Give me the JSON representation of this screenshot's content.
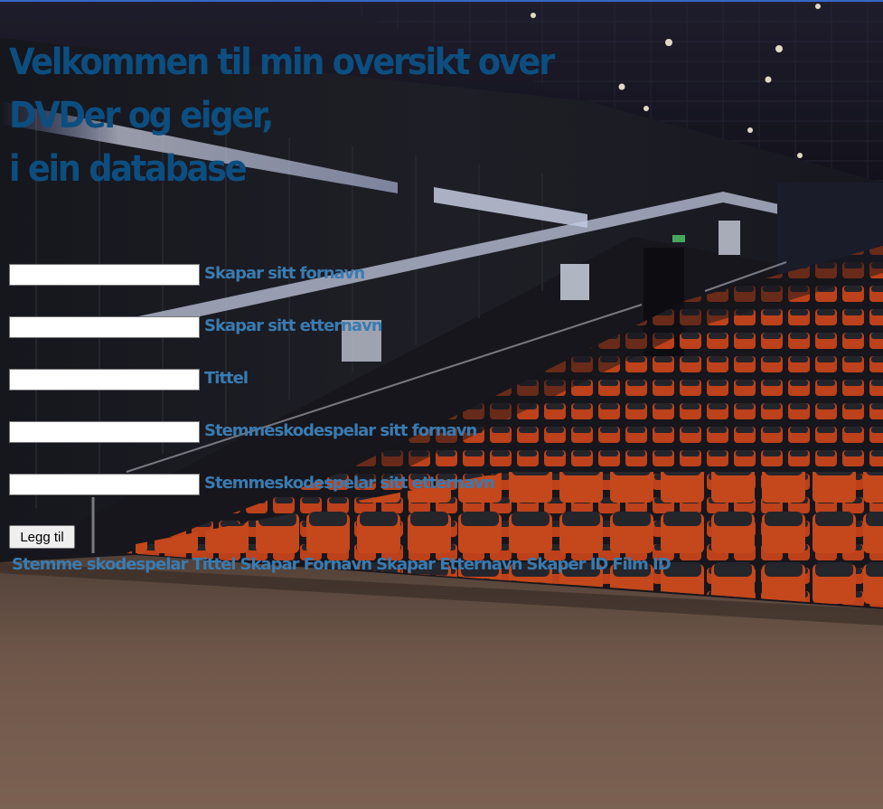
{
  "header": {
    "title_line1": "Velkommen til min oversikt over",
    "title_line2": "DVDer og eiger,",
    "title_line3": "i ein database"
  },
  "form": {
    "fields": [
      {
        "label": "Skapar sitt fornavn",
        "value": ""
      },
      {
        "label": "Skapar sitt etternavn",
        "value": ""
      },
      {
        "label": "Tittel",
        "value": ""
      },
      {
        "label": "Stemmeskodespelar sitt fornavn",
        "value": ""
      },
      {
        "label": "Stemmeskodespelar sitt etternavn",
        "value": ""
      }
    ],
    "submit_label": "Legg til"
  },
  "table": {
    "columns": [
      "Stemme skodespelar",
      "Tittel",
      "Skapar Fornavn",
      "Skapar Etternavn",
      "Skaper ID",
      "Film ID"
    ]
  },
  "colors": {
    "heading": "#0c4e80",
    "label": "#3a7bb0",
    "top_border": "#3566c9"
  }
}
